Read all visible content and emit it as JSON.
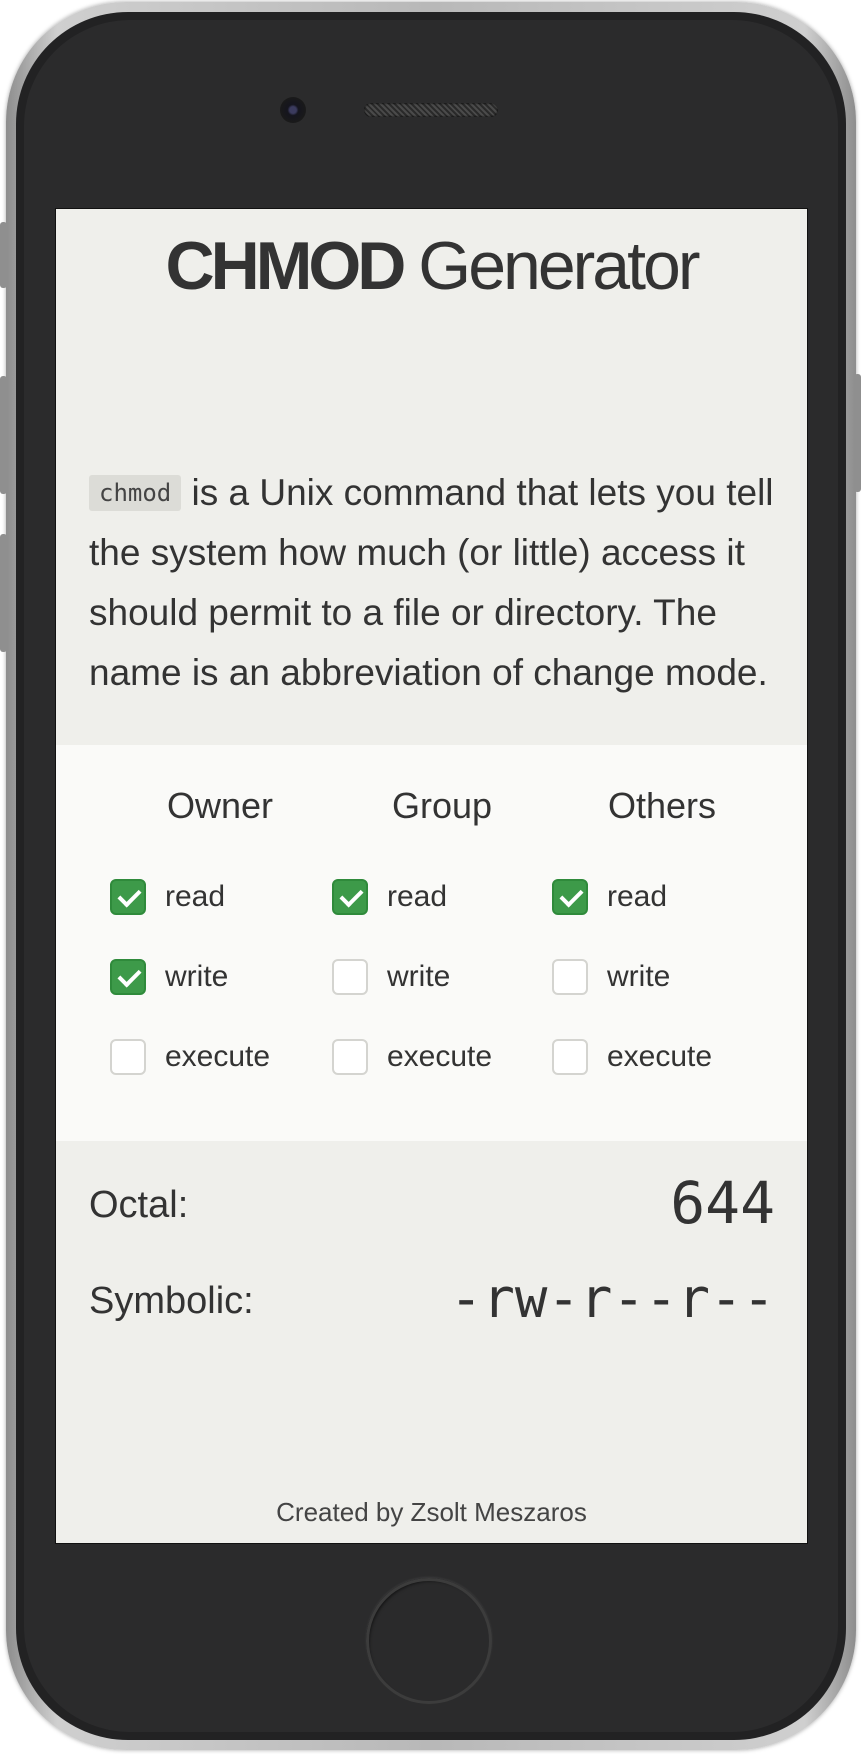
{
  "app": {
    "title_bold": "CHMOD",
    "title_light": "Generator",
    "code_term": "chmod",
    "description": "is a Unix command that lets you tell the system how much (or little) access it should permit to a file or directory. The name is an abbreviation of change mode."
  },
  "permissions": {
    "columns": [
      {
        "header": "Owner",
        "read": "read",
        "write": "write",
        "execute": "execute",
        "read_checked": true,
        "write_checked": true,
        "execute_checked": false
      },
      {
        "header": "Group",
        "read": "read",
        "write": "write",
        "execute": "execute",
        "read_checked": true,
        "write_checked": false,
        "execute_checked": false
      },
      {
        "header": "Others",
        "read": "read",
        "write": "write",
        "execute": "execute",
        "read_checked": true,
        "write_checked": false,
        "execute_checked": false
      }
    ]
  },
  "result": {
    "octal_label": "Octal:",
    "octal_value": "644",
    "symbolic_label": "Symbolic:",
    "symbolic_value": "-rw-r--r--"
  },
  "footer": {
    "credit": "Created by Zsolt Meszaros"
  },
  "colors": {
    "accent": "#3d9a49",
    "screen_bg": "#efefeb",
    "panel_bg": "#fafaf8"
  }
}
